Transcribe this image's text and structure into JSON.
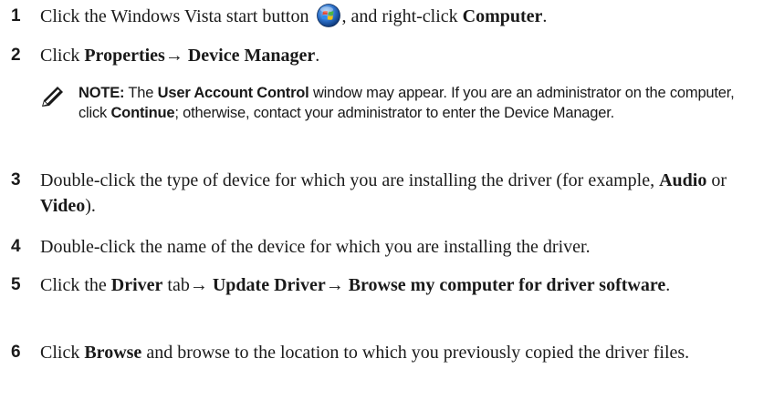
{
  "steps": [
    {
      "number": "1",
      "text_a": "Click the Windows Vista start button ",
      "text_b": ", and right-click ",
      "bold_1": "Computer",
      "text_c": ".",
      "icon": "windows-vista-start-orb-icon"
    },
    {
      "number": "2",
      "text_a": "Click ",
      "bold_1": "Properties→ Device Manager",
      "text_b": "."
    },
    {
      "number": "3",
      "text_a": "Double-click the type of device for which you are installing the driver (for example, ",
      "bold_1": "Audio",
      "text_b": " or ",
      "bold_2": "Video",
      "text_c": ")."
    },
    {
      "number": "4",
      "text_a": "Double-click the name of the device for which you are installing the driver."
    },
    {
      "number": "5",
      "text_a": "Click the ",
      "bold_1": "Driver",
      "text_b": " tab→ ",
      "bold_2": "Update Driver→ Browse my computer for driver software",
      "text_c": "."
    },
    {
      "number": "6",
      "text_a": "Click ",
      "bold_1": "Browse",
      "text_b": " and browse to the location to which you previously copied the driver files."
    }
  ],
  "note": {
    "icon": "note-pencil-icon",
    "label": "NOTE:",
    "text_a": " The ",
    "bold_1": "User Account Control",
    "text_b": " window may appear. If you are an administrator on the computer, click ",
    "bold_2": "Continue",
    "text_c": "; otherwise, contact your administrator to enter the Device Manager."
  },
  "colors": {
    "text": "#1a1a1a",
    "orb_blue": "#2a6fc9",
    "orb_red": "#e5462f",
    "orb_green": "#4bb543",
    "orb_yellow": "#f4c20d"
  }
}
